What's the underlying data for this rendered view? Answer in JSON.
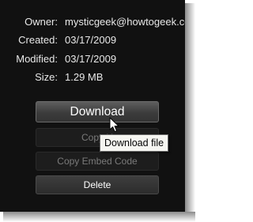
{
  "details": {
    "owner_label": "Owner:",
    "owner_value": "mysticgeek@howtogeek.com",
    "created_label": "Created:",
    "created_value": "03/17/2009",
    "modified_label": "Modified:",
    "modified_value": "03/17/2009",
    "size_label": "Size:",
    "size_value": "1.29 MB"
  },
  "actions": {
    "download_label": "Download",
    "copy_url_label": "Copy U",
    "copy_embed_label": "Copy Embed Code",
    "delete_label": "Delete"
  },
  "tooltip": {
    "text": "Download file"
  },
  "colors": {
    "panel_background": "#111111",
    "primary_button": "#4a4a4a",
    "tooltip_background": "#f6f6f2"
  },
  "icons": {
    "cursor": "pointer-cursor-icon"
  }
}
